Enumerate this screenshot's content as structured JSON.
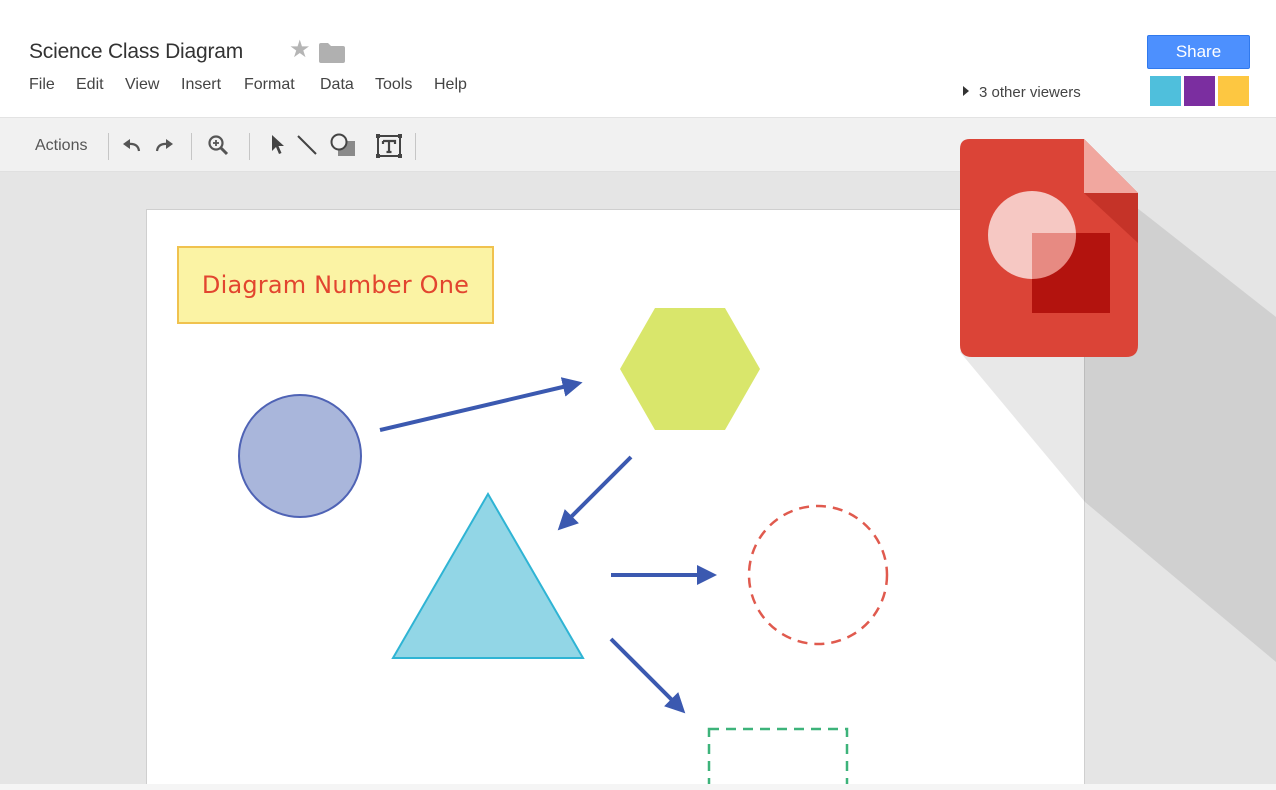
{
  "document": {
    "title": "Science Class Diagram",
    "star_icon": "star-icon",
    "folder_icon": "folder-icon"
  },
  "menu": {
    "items": [
      "File",
      "Edit",
      "View",
      "Insert",
      "Format",
      "Data",
      "Tools",
      "Help"
    ]
  },
  "share": {
    "label": "Share",
    "viewers_text": "3 other viewers",
    "viewer_colors": [
      "#4fbfdc",
      "#7b2ea0",
      "#fdc741"
    ]
  },
  "toolbar": {
    "actions_label": "Actions",
    "tools": [
      "undo-icon",
      "redo-icon",
      "zoom-icon",
      "select-arrow-icon",
      "line-icon",
      "shape-icon",
      "text-box-icon"
    ]
  },
  "canvas": {
    "title_box_text": "Diagram Number One",
    "shapes": [
      "circle",
      "hexagon",
      "triangle",
      "dashed-circle",
      "dashed-rectangle"
    ]
  },
  "colors": {
    "share_blue": "#4d90fe",
    "arrow": "#3b59b0",
    "circle_fill": "#a9b6db",
    "hexagon_fill": "#d9e66b",
    "triangle_fill": "#92d6e6",
    "dashed_circle": "#e05a4e",
    "dashed_rect": "#3db37a",
    "logo_red": "#db4437"
  }
}
